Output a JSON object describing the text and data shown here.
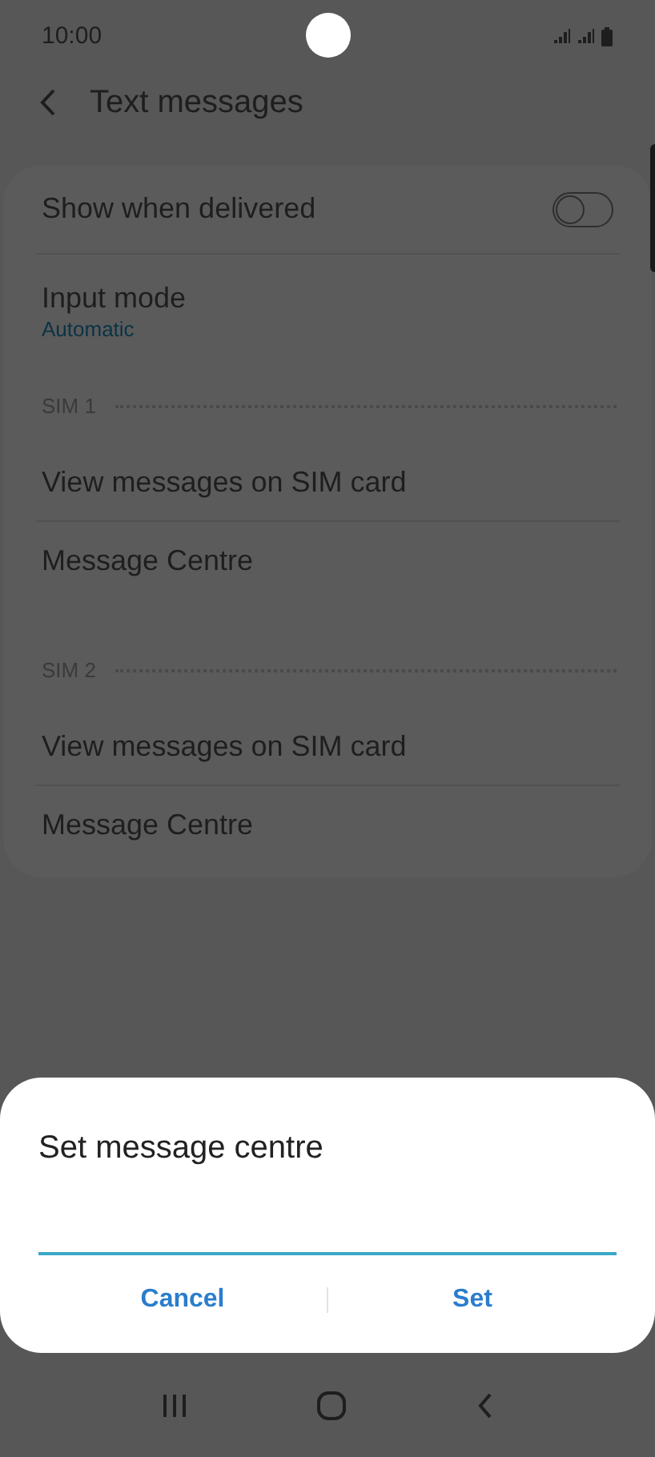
{
  "status_bar": {
    "time": "10:00"
  },
  "header": {
    "title": "Text messages"
  },
  "settings": [
    {
      "kind": "toggle",
      "label": "Show when delivered",
      "on": false
    },
    {
      "kind": "subtitle",
      "label": "Input mode",
      "value": "Automatic"
    },
    {
      "kind": "section",
      "label": "SIM 1"
    },
    {
      "kind": "plain",
      "label": "View messages on SIM card"
    },
    {
      "kind": "plain",
      "label": "Message Centre"
    },
    {
      "kind": "section",
      "label": "SIM 2"
    },
    {
      "kind": "plain",
      "label": "View messages on SIM card"
    },
    {
      "kind": "plain",
      "label": "Message Centre"
    }
  ],
  "dialog": {
    "title": "Set message centre",
    "buttons": [
      "Cancel",
      "Set"
    ]
  }
}
